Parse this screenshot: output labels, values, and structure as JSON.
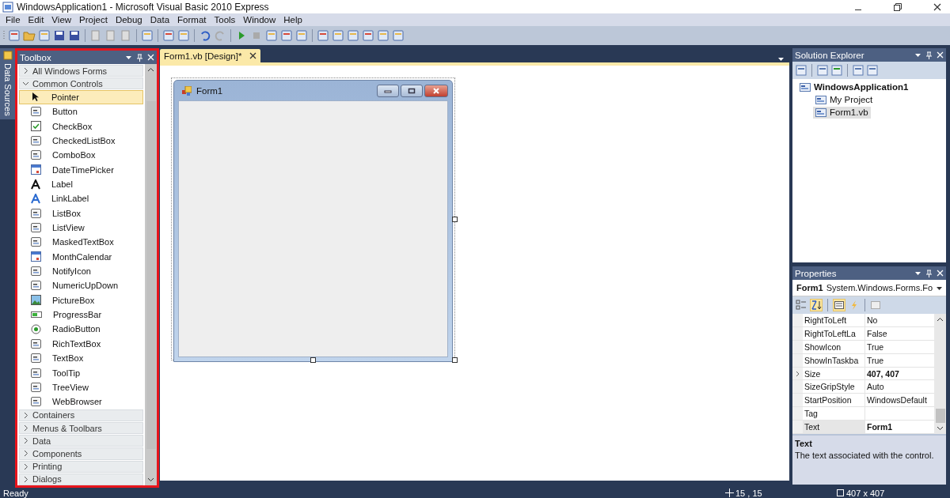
{
  "window": {
    "title": "WindowsApplication1 - Microsoft Visual Basic 2010 Express"
  },
  "menu": [
    "File",
    "Edit",
    "View",
    "Project",
    "Debug",
    "Data",
    "Format",
    "Tools",
    "Window",
    "Help"
  ],
  "side_tab": {
    "label": "Data Sources"
  },
  "toolbox": {
    "title": "Toolbox",
    "groups": [
      {
        "label": "All Windows Forms",
        "expanded": false
      },
      {
        "label": "Common Controls",
        "expanded": true,
        "items": [
          {
            "label": "Pointer",
            "selected": true
          },
          {
            "label": "Button",
            "selected": false
          },
          {
            "label": "CheckBox",
            "selected": false
          },
          {
            "label": "CheckedListBox",
            "selected": false
          },
          {
            "label": "ComboBox",
            "selected": false
          },
          {
            "label": "DateTimePicker",
            "selected": false
          },
          {
            "label": "Label",
            "selected": false
          },
          {
            "label": "LinkLabel",
            "selected": false
          },
          {
            "label": "ListBox",
            "selected": false
          },
          {
            "label": "ListView",
            "selected": false
          },
          {
            "label": "MaskedTextBox",
            "selected": false
          },
          {
            "label": "MonthCalendar",
            "selected": false
          },
          {
            "label": "NotifyIcon",
            "selected": false
          },
          {
            "label": "NumericUpDown",
            "selected": false
          },
          {
            "label": "PictureBox",
            "selected": false
          },
          {
            "label": "ProgressBar",
            "selected": false
          },
          {
            "label": "RadioButton",
            "selected": false
          },
          {
            "label": "RichTextBox",
            "selected": false
          },
          {
            "label": "TextBox",
            "selected": false
          },
          {
            "label": "ToolTip",
            "selected": false
          },
          {
            "label": "TreeView",
            "selected": false
          },
          {
            "label": "WebBrowser",
            "selected": false
          }
        ]
      },
      {
        "label": "Containers",
        "expanded": false
      },
      {
        "label": "Menus & Toolbars",
        "expanded": false
      },
      {
        "label": "Data",
        "expanded": false
      },
      {
        "label": "Components",
        "expanded": false
      },
      {
        "label": "Printing",
        "expanded": false
      },
      {
        "label": "Dialogs",
        "expanded": false
      }
    ]
  },
  "document_tabs": [
    {
      "label": "Form1.vb [Design]*",
      "selected": true
    }
  ],
  "form": {
    "title": "Form1"
  },
  "solution_explorer": {
    "title": "Solution Explorer",
    "tree": [
      {
        "label": "WindowsApplication1",
        "bold": true,
        "selected": false,
        "children": [
          {
            "label": "My Project",
            "bold": false,
            "selected": false
          },
          {
            "label": "Form1.vb",
            "bold": false,
            "selected": true
          }
        ]
      }
    ]
  },
  "properties": {
    "title": "Properties",
    "object_name": "Form1",
    "object_type": "System.Windows.Forms.Fo",
    "rows": [
      {
        "name": "RightToLeft",
        "value": "No",
        "bold": false,
        "expandable": false,
        "selected": false
      },
      {
        "name": "RightToLeftLa",
        "value": "False",
        "bold": false,
        "expandable": false,
        "selected": false
      },
      {
        "name": "ShowIcon",
        "value": "True",
        "bold": false,
        "expandable": false,
        "selected": false
      },
      {
        "name": "ShowInTaskba",
        "value": "True",
        "bold": false,
        "expandable": false,
        "selected": false
      },
      {
        "name": "Size",
        "value": "407, 407",
        "bold": true,
        "expandable": true,
        "selected": false
      },
      {
        "name": "SizeGripStyle",
        "value": "Auto",
        "bold": false,
        "expandable": false,
        "selected": false
      },
      {
        "name": "StartPosition",
        "value": "WindowsDefault",
        "bold": false,
        "expandable": false,
        "selected": false
      },
      {
        "name": "Tag",
        "expandable": false,
        "selected": false
      },
      {
        "name": "Text",
        "value": "Form1",
        "bold": true,
        "expandable": false,
        "selected": true
      }
    ],
    "description_title": "Text",
    "description": "The text associated with the control."
  },
  "status_bar": {
    "text": "Ready",
    "position": "15 , 15",
    "size": "407 x 407"
  }
}
